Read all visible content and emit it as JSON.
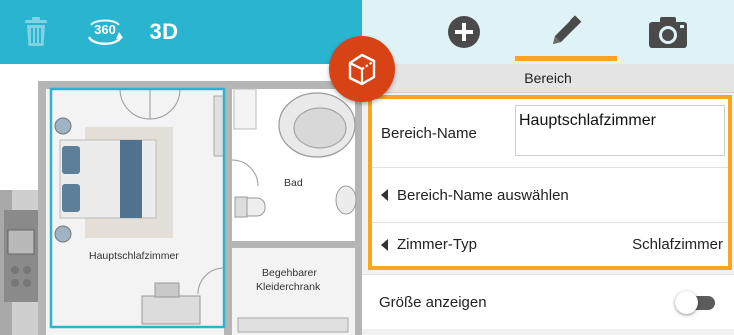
{
  "left_toolbar": {
    "icons": [
      "trash-icon",
      "view-360-icon"
    ],
    "view_3d_label": "3D"
  },
  "floor_plan": {
    "rooms": [
      {
        "name": "Hauptschlafzimmer"
      },
      {
        "name": "Bad"
      },
      {
        "name": "Begehbarer\nKleiderchrank",
        "line1": "Begehbarer",
        "line2": "Kleiderchrank"
      }
    ]
  },
  "badge": {
    "icon": "room-cube-icon"
  },
  "right_toolbar": {
    "tabs": [
      {
        "icon": "add-icon"
      },
      {
        "icon": "pencil-icon",
        "selected": true
      },
      {
        "icon": "camera-icon"
      }
    ]
  },
  "properties": {
    "section_title": "Bereich",
    "room_name_label": "Bereich-Name",
    "room_name_value": "Hauptschlafzimmer",
    "select_name_label": "Bereich-Name auswählen",
    "room_type_label": "Zimmer-Typ",
    "room_type_value": "Schlafzimmer",
    "show_size_label": "Größe anzeigen",
    "show_size_enabled": false
  },
  "colors": {
    "toolbar_teal": "#29b5cf",
    "right_toolbar_bg": "#dff3f7",
    "accent_orange": "#f6a623",
    "badge_orange": "#d84315",
    "icon_dark": "#4a4a4a",
    "selection_cyan": "#29b5cf"
  }
}
